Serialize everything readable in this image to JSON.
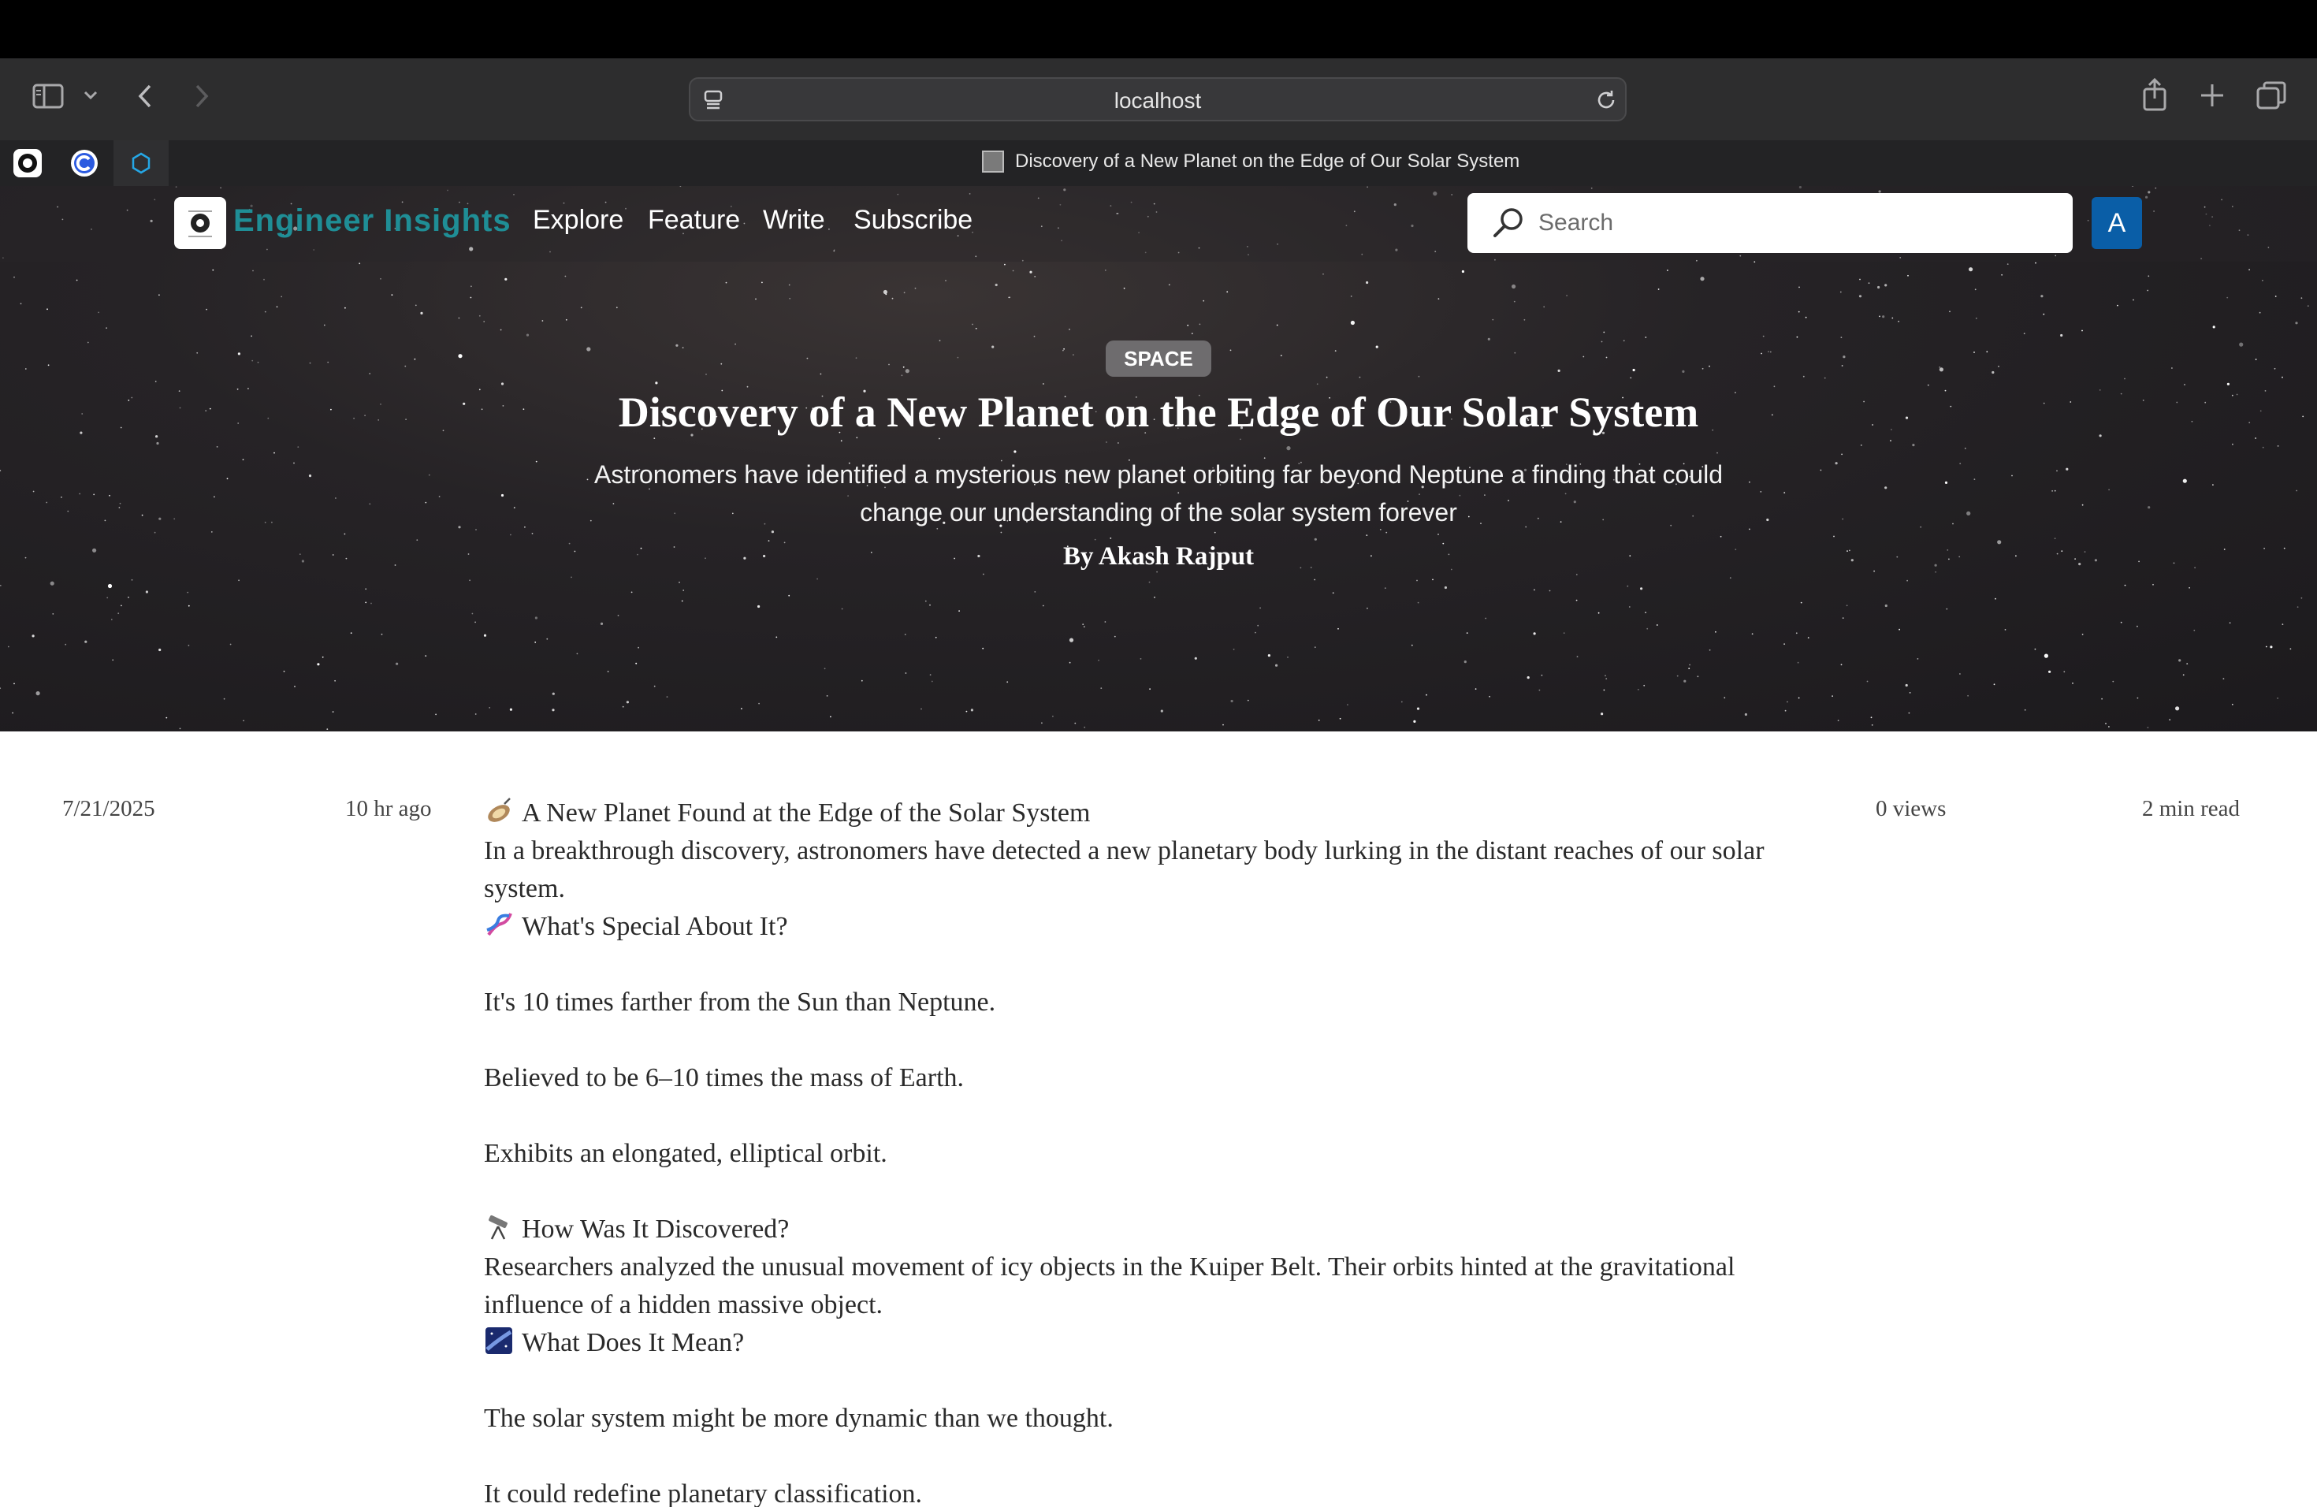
{
  "browser": {
    "url_host": "localhost",
    "active_tab_title": "Discovery of a New Planet on the Edge of Our Solar System"
  },
  "site": {
    "brand": "Engineer Insights",
    "nav": [
      "Explore",
      "Feature",
      "Write",
      "Subscribe"
    ],
    "search_placeholder": "Search",
    "avatar_initial": "A",
    "avatar_color": "#0a5ea7",
    "brand_color": "#1f8e96"
  },
  "hero": {
    "category": "SPACE",
    "title": "Discovery of a New Planet on the Edge of Our Solar System",
    "subtitle": "Astronomers have identified a mysterious new planet orbiting far beyond Neptune a finding that could change our understanding of the solar system forever",
    "author": "By Akash Rajput"
  },
  "meta": {
    "date": "7/21/2025",
    "relative_time": "10 hr ago",
    "views": "0 views",
    "read_time": "2 min read"
  },
  "article": {
    "heading_1": "A New Planet Found at the Edge of the Solar System",
    "paragraph_1": "In a breakthrough discovery, astronomers have detected a new planetary body lurking in the distant reaches of our solar system.",
    "heading_2": "What's Special About It?",
    "fact_1": "It's 10 times farther from the Sun than Neptune.",
    "fact_2": "Believed to be 6–10 times the mass of Earth.",
    "fact_3": "Exhibits an elongated, elliptical orbit.",
    "heading_3": "How Was It Discovered?",
    "paragraph_2": "Researchers analyzed the unusual movement of icy objects in the Kuiper Belt. Their orbits hinted at the gravitational influence of a hidden massive object.",
    "heading_4": "What Does It Mean?",
    "meaning_1": "The solar system might be more dynamic than we thought.",
    "meaning_2": "It could redefine planetary classification."
  }
}
